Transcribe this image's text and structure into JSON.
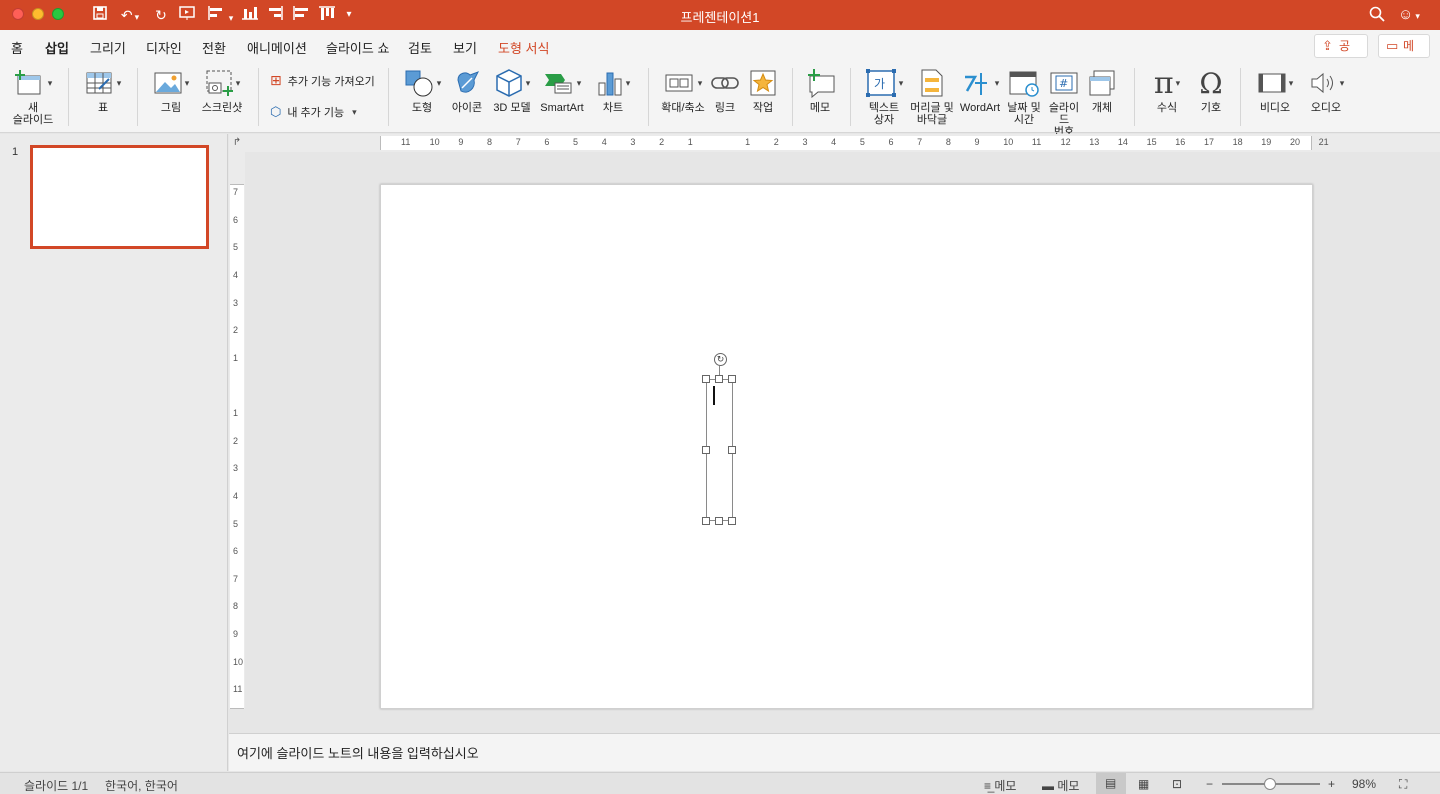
{
  "window": {
    "title": "프레젠테이션1",
    "quick_access_icons": [
      "save-icon",
      "undo-icon",
      "redo-icon",
      "slideshow-icon",
      "align-left-icon",
      "distribute-icon",
      "align-right-icon",
      "align-center-icon",
      "align-top-icon",
      "more-icon"
    ],
    "right_icons": [
      "search-icon",
      "smiley-icon"
    ]
  },
  "colors": {
    "accent": "#d24726",
    "ribbon_bg": "#f4f4f4",
    "canvas_bg": "#e6e6e6"
  },
  "tabs": [
    {
      "label": "홈"
    },
    {
      "label": "삽입",
      "active": true
    },
    {
      "label": "그리기"
    },
    {
      "label": "디자인"
    },
    {
      "label": "전환"
    },
    {
      "label": "애니메이션"
    },
    {
      "label": "슬라이드 쇼"
    },
    {
      "label": "검토"
    },
    {
      "label": "보기"
    },
    {
      "label": "도형 서식",
      "contextual": true
    }
  ],
  "share_label": "공유",
  "comments_label": "메모",
  "ribbon": {
    "new_slide": "새\n슬라이드",
    "table": "표",
    "picture": "그림",
    "screenshot": "스크린샷",
    "get_addins": "추가 기능 가져오기",
    "my_addins": "내 추가 기능",
    "shapes": "도형",
    "icons": "아이콘",
    "models3d": "3D 모델",
    "smartart": "SmartArt",
    "chart": "차트",
    "zoom": "확대/축소",
    "link": "링크",
    "action": "작업",
    "comment": "메모",
    "textbox": "텍스트\n상자",
    "header_footer": "머리글 및\n바닥글",
    "wordart": "WordArt",
    "datetime": "날짜 및\n시간",
    "slide_number": "슬라이드\n번호",
    "object": "개체",
    "equation": "수식",
    "symbol": "기호",
    "video": "비디오",
    "audio": "오디오"
  },
  "thumbnails": {
    "slide_number": "1"
  },
  "ruler": {
    "h_ticks": [
      "11",
      "10",
      "9",
      "8",
      "7",
      "6",
      "5",
      "4",
      "3",
      "2",
      "1",
      "",
      "1",
      "2",
      "3",
      "4",
      "5",
      "6",
      "7",
      "8",
      "9",
      "10",
      "11",
      "12",
      "13",
      "14",
      "15",
      "16",
      "17",
      "18",
      "19",
      "20",
      "21"
    ],
    "v_ticks": [
      "7",
      "6",
      "5",
      "4",
      "3",
      "2",
      "1",
      "",
      "1",
      "2",
      "3",
      "4",
      "5",
      "6",
      "7",
      "8",
      "9",
      "10",
      "11"
    ]
  },
  "notes_placeholder": "여기에 슬라이드 노트의 내용을 입력하십시오",
  "status": {
    "slide_info": "슬라이드 1/1",
    "language": "한국어, 한국어",
    "notes_label": "메모",
    "comments_label": "메모",
    "zoom_percent": "98%",
    "zoom_minus": "−",
    "zoom_plus": "+"
  }
}
